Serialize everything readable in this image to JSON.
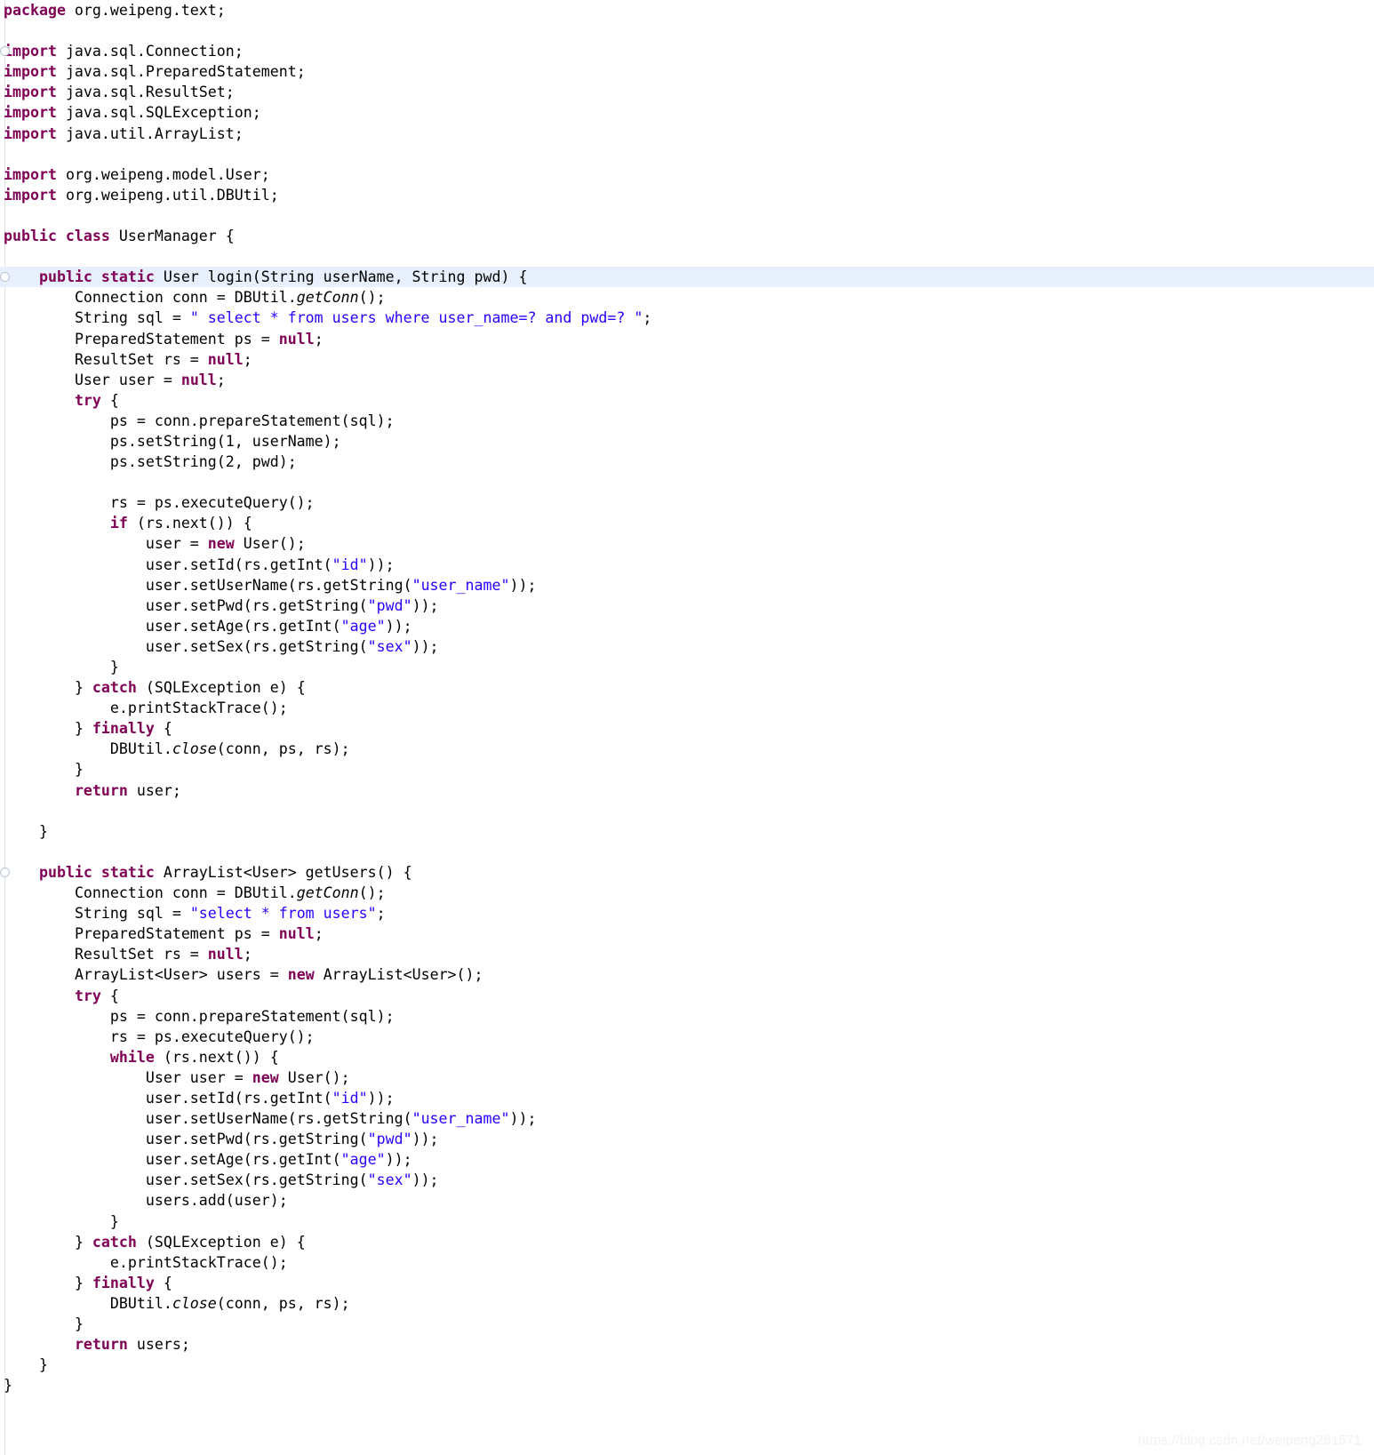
{
  "editor": {
    "language": "java",
    "file_name": "UserManager.java",
    "colors": {
      "background": "#ffffff",
      "text": "#000000",
      "keyword": "#7f0055",
      "string": "#2a00ff",
      "current_line_highlight": "#e8f0fd",
      "gutter_rule": "#e4e4e4",
      "watermark": "#f2f2f2"
    },
    "highlighted_line_number": 11
  },
  "watermark": {
    "text": "https://blog.csdn.net/weipeng261571"
  },
  "code": {
    "lines": [
      {
        "n": 1,
        "indent": 0,
        "tokens": [
          {
            "t": "kw",
            "v": "package"
          },
          {
            "t": "plain",
            "v": " org.weipeng.text;"
          }
        ]
      },
      {
        "n": 2,
        "indent": 0,
        "tokens": []
      },
      {
        "n": 3,
        "indent": 0,
        "marker": true,
        "tokens": [
          {
            "t": "kw",
            "v": "import"
          },
          {
            "t": "plain",
            "v": " java.sql.Connection;"
          }
        ]
      },
      {
        "n": 4,
        "indent": 0,
        "tokens": [
          {
            "t": "kw",
            "v": "import"
          },
          {
            "t": "plain",
            "v": " java.sql.PreparedStatement;"
          }
        ]
      },
      {
        "n": 5,
        "indent": 0,
        "tokens": [
          {
            "t": "kw",
            "v": "import"
          },
          {
            "t": "plain",
            "v": " java.sql.ResultSet;"
          }
        ]
      },
      {
        "n": 6,
        "indent": 0,
        "tokens": [
          {
            "t": "kw",
            "v": "import"
          },
          {
            "t": "plain",
            "v": " java.sql.SQLException;"
          }
        ]
      },
      {
        "n": 7,
        "indent": 0,
        "tokens": [
          {
            "t": "kw",
            "v": "import"
          },
          {
            "t": "plain",
            "v": " java.util.ArrayList;"
          }
        ]
      },
      {
        "n": 8,
        "indent": 0,
        "tokens": []
      },
      {
        "n": 9,
        "indent": 0,
        "tokens": [
          {
            "t": "kw",
            "v": "import"
          },
          {
            "t": "plain",
            "v": " org.weipeng.model.User;"
          }
        ]
      },
      {
        "n": 10,
        "indent": 0,
        "tokens": [
          {
            "t": "kw",
            "v": "import"
          },
          {
            "t": "plain",
            "v": " org.weipeng.util.DBUtil;"
          }
        ]
      },
      {
        "n": 11,
        "indent": 0,
        "tokens": []
      },
      {
        "n": 12,
        "indent": 0,
        "tokens": [
          {
            "t": "kw",
            "v": "public class"
          },
          {
            "t": "plain",
            "v": " UserManager {"
          }
        ]
      },
      {
        "n": 13,
        "indent": 0,
        "tokens": []
      },
      {
        "n": 14,
        "indent": 1,
        "highlight": true,
        "marker": true,
        "tokens": [
          {
            "t": "kw",
            "v": "public static"
          },
          {
            "t": "plain",
            "v": " User login(String userName, String pwd) {"
          }
        ]
      },
      {
        "n": 15,
        "indent": 2,
        "tokens": [
          {
            "t": "plain",
            "v": "Connection conn = DBUtil."
          },
          {
            "t": "static-call",
            "v": "getConn"
          },
          {
            "t": "plain",
            "v": "();"
          }
        ]
      },
      {
        "n": 16,
        "indent": 2,
        "tokens": [
          {
            "t": "plain",
            "v": "String sql = "
          },
          {
            "t": "str",
            "v": "\" select * from users where user_name=? and pwd=? \""
          },
          {
            "t": "plain",
            "v": ";"
          }
        ]
      },
      {
        "n": 17,
        "indent": 2,
        "tokens": [
          {
            "t": "plain",
            "v": "PreparedStatement ps = "
          },
          {
            "t": "kw",
            "v": "null"
          },
          {
            "t": "plain",
            "v": ";"
          }
        ]
      },
      {
        "n": 18,
        "indent": 2,
        "tokens": [
          {
            "t": "plain",
            "v": "ResultSet rs = "
          },
          {
            "t": "kw",
            "v": "null"
          },
          {
            "t": "plain",
            "v": ";"
          }
        ]
      },
      {
        "n": 19,
        "indent": 2,
        "tokens": [
          {
            "t": "plain",
            "v": "User user = "
          },
          {
            "t": "kw",
            "v": "null"
          },
          {
            "t": "plain",
            "v": ";"
          }
        ]
      },
      {
        "n": 20,
        "indent": 2,
        "tokens": [
          {
            "t": "kw",
            "v": "try"
          },
          {
            "t": "plain",
            "v": " {"
          }
        ]
      },
      {
        "n": 21,
        "indent": 3,
        "tokens": [
          {
            "t": "plain",
            "v": "ps = conn.prepareStatement(sql);"
          }
        ]
      },
      {
        "n": 22,
        "indent": 3,
        "tokens": [
          {
            "t": "plain",
            "v": "ps.setString(1, userName);"
          }
        ]
      },
      {
        "n": 23,
        "indent": 3,
        "tokens": [
          {
            "t": "plain",
            "v": "ps.setString(2, pwd);"
          }
        ]
      },
      {
        "n": 24,
        "indent": 0,
        "tokens": []
      },
      {
        "n": 25,
        "indent": 3,
        "tokens": [
          {
            "t": "plain",
            "v": "rs = ps.executeQuery();"
          }
        ]
      },
      {
        "n": 26,
        "indent": 3,
        "tokens": [
          {
            "t": "kw",
            "v": "if"
          },
          {
            "t": "plain",
            "v": " (rs.next()) {"
          }
        ]
      },
      {
        "n": 27,
        "indent": 4,
        "tokens": [
          {
            "t": "plain",
            "v": "user = "
          },
          {
            "t": "kw",
            "v": "new"
          },
          {
            "t": "plain",
            "v": " User();"
          }
        ]
      },
      {
        "n": 28,
        "indent": 4,
        "tokens": [
          {
            "t": "plain",
            "v": "user.setId(rs.getInt("
          },
          {
            "t": "str",
            "v": "\"id\""
          },
          {
            "t": "plain",
            "v": "));"
          }
        ]
      },
      {
        "n": 29,
        "indent": 4,
        "tokens": [
          {
            "t": "plain",
            "v": "user.setUserName(rs.getString("
          },
          {
            "t": "str",
            "v": "\"user_name\""
          },
          {
            "t": "plain",
            "v": "));"
          }
        ]
      },
      {
        "n": 30,
        "indent": 4,
        "tokens": [
          {
            "t": "plain",
            "v": "user.setPwd(rs.getString("
          },
          {
            "t": "str",
            "v": "\"pwd\""
          },
          {
            "t": "plain",
            "v": "));"
          }
        ]
      },
      {
        "n": 31,
        "indent": 4,
        "tokens": [
          {
            "t": "plain",
            "v": "user.setAge(rs.getInt("
          },
          {
            "t": "str",
            "v": "\"age\""
          },
          {
            "t": "plain",
            "v": "));"
          }
        ]
      },
      {
        "n": 32,
        "indent": 4,
        "tokens": [
          {
            "t": "plain",
            "v": "user.setSex(rs.getString("
          },
          {
            "t": "str",
            "v": "\"sex\""
          },
          {
            "t": "plain",
            "v": "));"
          }
        ]
      },
      {
        "n": 33,
        "indent": 3,
        "tokens": [
          {
            "t": "plain",
            "v": "}"
          }
        ]
      },
      {
        "n": 34,
        "indent": 2,
        "tokens": [
          {
            "t": "plain",
            "v": "} "
          },
          {
            "t": "kw",
            "v": "catch"
          },
          {
            "t": "plain",
            "v": " (SQLException e) {"
          }
        ]
      },
      {
        "n": 35,
        "indent": 3,
        "tokens": [
          {
            "t": "plain",
            "v": "e.printStackTrace();"
          }
        ]
      },
      {
        "n": 36,
        "indent": 2,
        "tokens": [
          {
            "t": "plain",
            "v": "} "
          },
          {
            "t": "kw",
            "v": "finally"
          },
          {
            "t": "plain",
            "v": " {"
          }
        ]
      },
      {
        "n": 37,
        "indent": 3,
        "tokens": [
          {
            "t": "plain",
            "v": "DBUtil."
          },
          {
            "t": "static-call",
            "v": "close"
          },
          {
            "t": "plain",
            "v": "(conn, ps, rs);"
          }
        ]
      },
      {
        "n": 38,
        "indent": 2,
        "tokens": [
          {
            "t": "plain",
            "v": "}"
          }
        ]
      },
      {
        "n": 39,
        "indent": 2,
        "tokens": [
          {
            "t": "kw",
            "v": "return"
          },
          {
            "t": "plain",
            "v": " user;"
          }
        ]
      },
      {
        "n": 40,
        "indent": 0,
        "tokens": []
      },
      {
        "n": 41,
        "indent": 1,
        "tokens": [
          {
            "t": "plain",
            "v": "}"
          }
        ]
      },
      {
        "n": 42,
        "indent": 0,
        "tokens": []
      },
      {
        "n": 43,
        "indent": 1,
        "marker": true,
        "tokens": [
          {
            "t": "kw",
            "v": "public static"
          },
          {
            "t": "plain",
            "v": " ArrayList<User> getUsers() {"
          }
        ]
      },
      {
        "n": 44,
        "indent": 2,
        "tokens": [
          {
            "t": "plain",
            "v": "Connection conn = DBUtil."
          },
          {
            "t": "static-call",
            "v": "getConn"
          },
          {
            "t": "plain",
            "v": "();"
          }
        ]
      },
      {
        "n": 45,
        "indent": 2,
        "tokens": [
          {
            "t": "plain",
            "v": "String sql = "
          },
          {
            "t": "str",
            "v": "\"select * from users\""
          },
          {
            "t": "plain",
            "v": ";"
          }
        ]
      },
      {
        "n": 46,
        "indent": 2,
        "tokens": [
          {
            "t": "plain",
            "v": "PreparedStatement ps = "
          },
          {
            "t": "kw",
            "v": "null"
          },
          {
            "t": "plain",
            "v": ";"
          }
        ]
      },
      {
        "n": 47,
        "indent": 2,
        "tokens": [
          {
            "t": "plain",
            "v": "ResultSet rs = "
          },
          {
            "t": "kw",
            "v": "null"
          },
          {
            "t": "plain",
            "v": ";"
          }
        ]
      },
      {
        "n": 48,
        "indent": 2,
        "tokens": [
          {
            "t": "plain",
            "v": "ArrayList<User> users = "
          },
          {
            "t": "kw",
            "v": "new"
          },
          {
            "t": "plain",
            "v": " ArrayList<User>();"
          }
        ]
      },
      {
        "n": 49,
        "indent": 2,
        "tokens": [
          {
            "t": "kw",
            "v": "try"
          },
          {
            "t": "plain",
            "v": " {"
          }
        ]
      },
      {
        "n": 50,
        "indent": 3,
        "tokens": [
          {
            "t": "plain",
            "v": "ps = conn.prepareStatement(sql);"
          }
        ]
      },
      {
        "n": 51,
        "indent": 3,
        "tokens": [
          {
            "t": "plain",
            "v": "rs = ps.executeQuery();"
          }
        ]
      },
      {
        "n": 52,
        "indent": 3,
        "tokens": [
          {
            "t": "kw",
            "v": "while"
          },
          {
            "t": "plain",
            "v": " (rs.next()) {"
          }
        ]
      },
      {
        "n": 53,
        "indent": 4,
        "tokens": [
          {
            "t": "plain",
            "v": "User user = "
          },
          {
            "t": "kw",
            "v": "new"
          },
          {
            "t": "plain",
            "v": " User();"
          }
        ]
      },
      {
        "n": 54,
        "indent": 4,
        "tokens": [
          {
            "t": "plain",
            "v": "user.setId(rs.getInt("
          },
          {
            "t": "str",
            "v": "\"id\""
          },
          {
            "t": "plain",
            "v": "));"
          }
        ]
      },
      {
        "n": 55,
        "indent": 4,
        "tokens": [
          {
            "t": "plain",
            "v": "user.setUserName(rs.getString("
          },
          {
            "t": "str",
            "v": "\"user_name\""
          },
          {
            "t": "plain",
            "v": "));"
          }
        ]
      },
      {
        "n": 56,
        "indent": 4,
        "tokens": [
          {
            "t": "plain",
            "v": "user.setPwd(rs.getString("
          },
          {
            "t": "str",
            "v": "\"pwd\""
          },
          {
            "t": "plain",
            "v": "));"
          }
        ]
      },
      {
        "n": 57,
        "indent": 4,
        "tokens": [
          {
            "t": "plain",
            "v": "user.setAge(rs.getInt("
          },
          {
            "t": "str",
            "v": "\"age\""
          },
          {
            "t": "plain",
            "v": "));"
          }
        ]
      },
      {
        "n": 58,
        "indent": 4,
        "tokens": [
          {
            "t": "plain",
            "v": "user.setSex(rs.getString("
          },
          {
            "t": "str",
            "v": "\"sex\""
          },
          {
            "t": "plain",
            "v": "));"
          }
        ]
      },
      {
        "n": 59,
        "indent": 4,
        "tokens": [
          {
            "t": "plain",
            "v": "users.add(user);"
          }
        ]
      },
      {
        "n": 60,
        "indent": 3,
        "tokens": [
          {
            "t": "plain",
            "v": "}"
          }
        ]
      },
      {
        "n": 61,
        "indent": 2,
        "tokens": [
          {
            "t": "plain",
            "v": "} "
          },
          {
            "t": "kw",
            "v": "catch"
          },
          {
            "t": "plain",
            "v": " (SQLException e) {"
          }
        ]
      },
      {
        "n": 62,
        "indent": 3,
        "tokens": [
          {
            "t": "plain",
            "v": "e.printStackTrace();"
          }
        ]
      },
      {
        "n": 63,
        "indent": 2,
        "tokens": [
          {
            "t": "plain",
            "v": "} "
          },
          {
            "t": "kw",
            "v": "finally"
          },
          {
            "t": "plain",
            "v": " {"
          }
        ]
      },
      {
        "n": 64,
        "indent": 3,
        "tokens": [
          {
            "t": "plain",
            "v": "DBUtil."
          },
          {
            "t": "static-call",
            "v": "close"
          },
          {
            "t": "plain",
            "v": "(conn, ps, rs);"
          }
        ]
      },
      {
        "n": 65,
        "indent": 2,
        "tokens": [
          {
            "t": "plain",
            "v": "}"
          }
        ]
      },
      {
        "n": 66,
        "indent": 2,
        "tokens": [
          {
            "t": "kw",
            "v": "return"
          },
          {
            "t": "plain",
            "v": " users;"
          }
        ]
      },
      {
        "n": 67,
        "indent": 1,
        "tokens": [
          {
            "t": "plain",
            "v": "}"
          }
        ]
      },
      {
        "n": 68,
        "indent": 0,
        "tokens": [
          {
            "t": "plain",
            "v": "}"
          }
        ]
      }
    ]
  }
}
